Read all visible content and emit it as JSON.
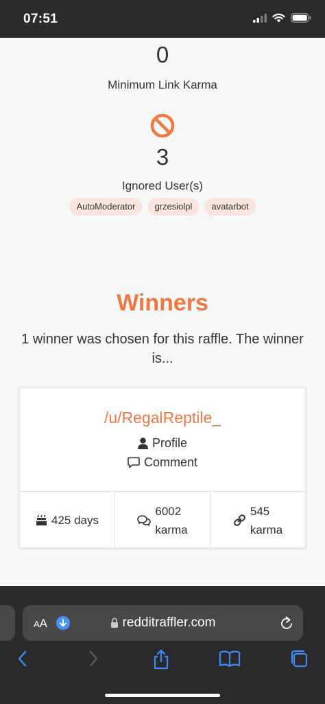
{
  "status_bar": {
    "time": "07:51"
  },
  "stats": {
    "min_link_karma": {
      "value": "0",
      "label": "Minimum Link Karma"
    },
    "ignored_users": {
      "count": "3",
      "label": "Ignored User(s)",
      "users": [
        "AutoModerator",
        "grzesiolpl",
        "avatarbot"
      ]
    }
  },
  "winners": {
    "title": "Winners",
    "description": "1 winner was chosen for this raffle. The winner is...",
    "card": {
      "username": "/u/RegalReptile_",
      "profile_label": "Profile",
      "comment_label": "Comment",
      "age": "425 days",
      "comment_karma_value": "6002",
      "comment_karma_unit": "karma",
      "link_karma_value": "545",
      "link_karma_unit": "karma"
    }
  },
  "browser": {
    "aa_label_small": "A",
    "aa_label_large": "A",
    "url": "redditraffler.com"
  },
  "colors": {
    "accent": "#ef7845",
    "chip_bg": "#fbe6df",
    "chrome": "#2a2a2c"
  }
}
